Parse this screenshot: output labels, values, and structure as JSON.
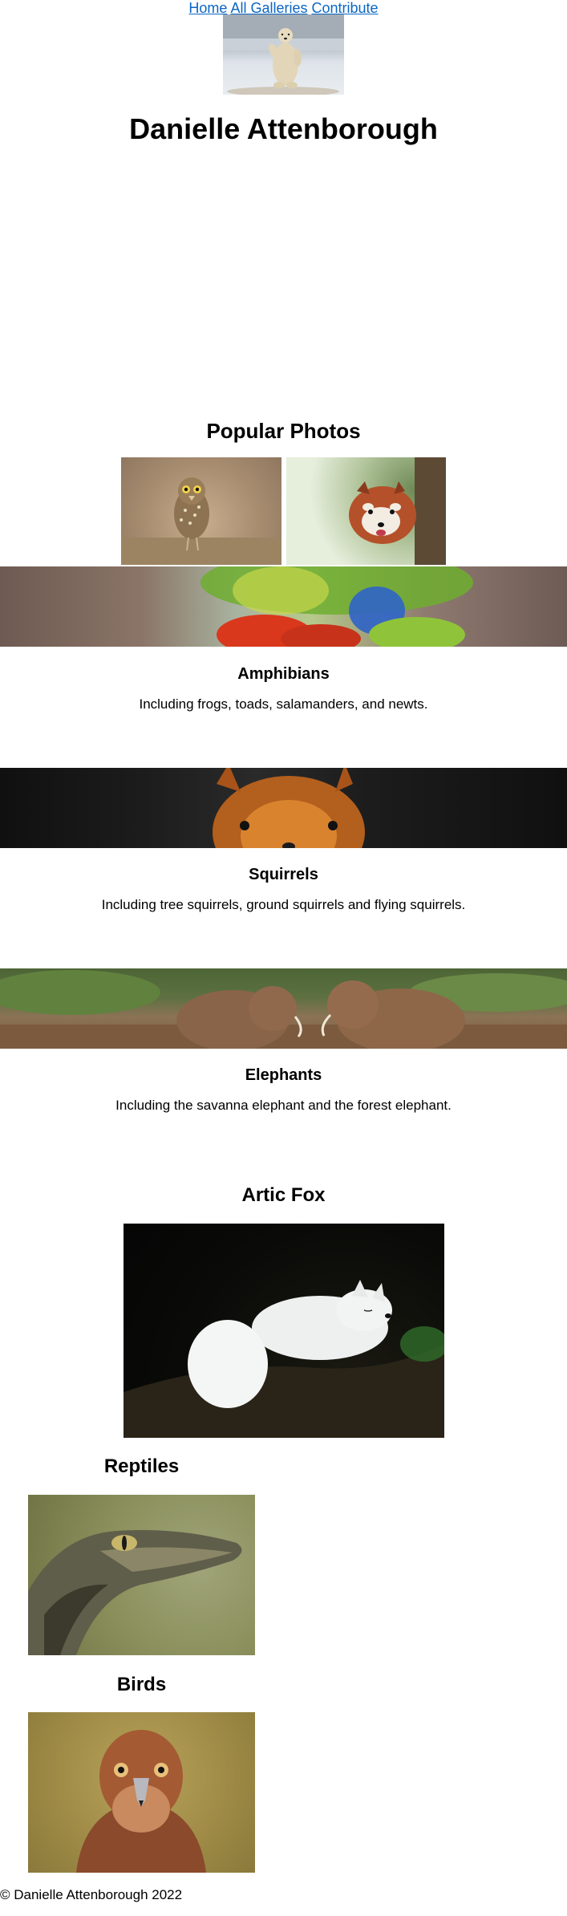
{
  "nav": {
    "home": "Home",
    "all_galleries": "All Galleries",
    "contribute": "Contribute"
  },
  "header": {
    "title": "Danielle Attenborough"
  },
  "popular": {
    "title": "Popular Photos"
  },
  "categories": [
    {
      "title": "Amphibians",
      "description": "Including frogs, toads, salamanders, and newts."
    },
    {
      "title": "Squirrels",
      "description": "Including tree squirrels, ground squirrels and flying squirrels."
    },
    {
      "title": "Elephants",
      "description": "Including the savanna elephant and the forest elephant."
    }
  ],
  "features": {
    "fox_title": "Artic Fox",
    "reptiles_title": "Reptiles",
    "birds_title": "Birds"
  },
  "footer": {
    "text": "© Danielle Attenborough 2022"
  }
}
